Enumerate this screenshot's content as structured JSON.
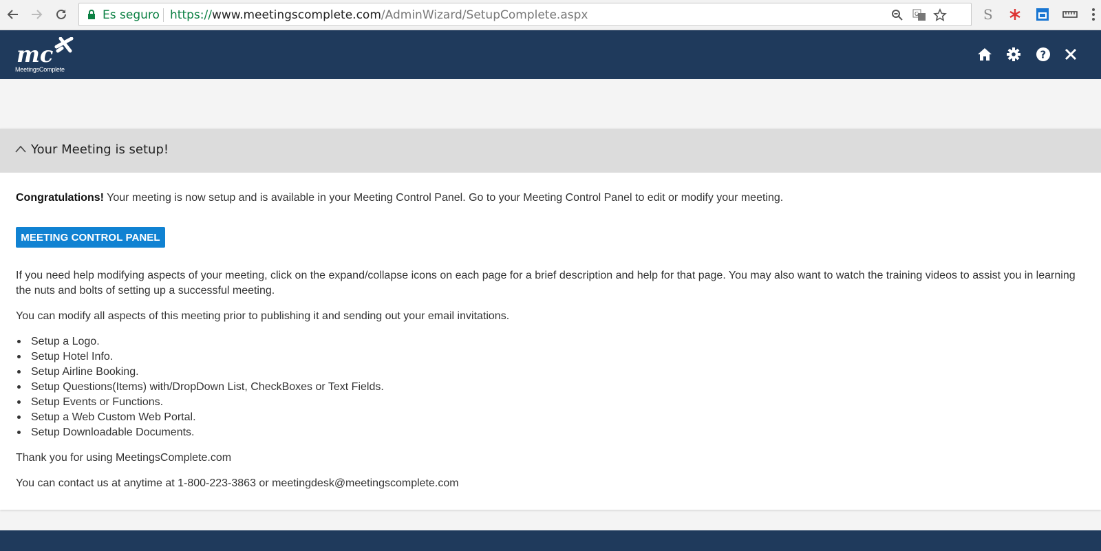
{
  "browser": {
    "secure_label": "Es seguro",
    "url_scheme": "https://",
    "url_host": "www.meetingscomplete.com",
    "url_path": "/AdminWizard/SetupComplete.aspx"
  },
  "header": {
    "logo_text": "mc",
    "logo_tagline": "MeetingsComplete",
    "icons": [
      "home-icon",
      "gear-icon",
      "help-icon",
      "close-icon"
    ]
  },
  "panel": {
    "title": "Your Meeting is setup!",
    "congrats_bold": "Congratulations!",
    "congrats_text": " Your meeting is now setup and is available in your Meeting Control Panel. Go to your Meeting Control Panel to edit or modify your meeting.",
    "button_label": "MEETING CONTROL PANEL",
    "help_text": "If you need help modifying aspects of your meeting, click on the expand/collapse icons on each page for a brief description and help for that page. You may also want to watch the training videos to assist you in learning the nuts and bolts of setting up a successful meeting.",
    "modify_text": "You can modify all aspects of this meeting prior to publishing it and sending out your email invitations.",
    "steps": [
      "Setup a Logo.",
      "Setup Hotel Info.",
      "Setup Airline Booking.",
      "Setup Questions(Items) with/DropDown List, CheckBoxes or Text Fields.",
      "Setup Events or Functions.",
      "Setup a Web Custom Web Portal.",
      "Setup Downloadable Documents."
    ],
    "thanks_text": "Thank you for using MeetingsComplete.com",
    "contact_text": "You can contact us at anytime at 1-800-223-3863 or meetingdesk@meetingscomplete.com"
  },
  "colors": {
    "header_bg": "#1f3a5c",
    "button_bg": "#1082d2",
    "panel_head_bg": "#dcdcdc",
    "secure_green": "#0b8043"
  }
}
